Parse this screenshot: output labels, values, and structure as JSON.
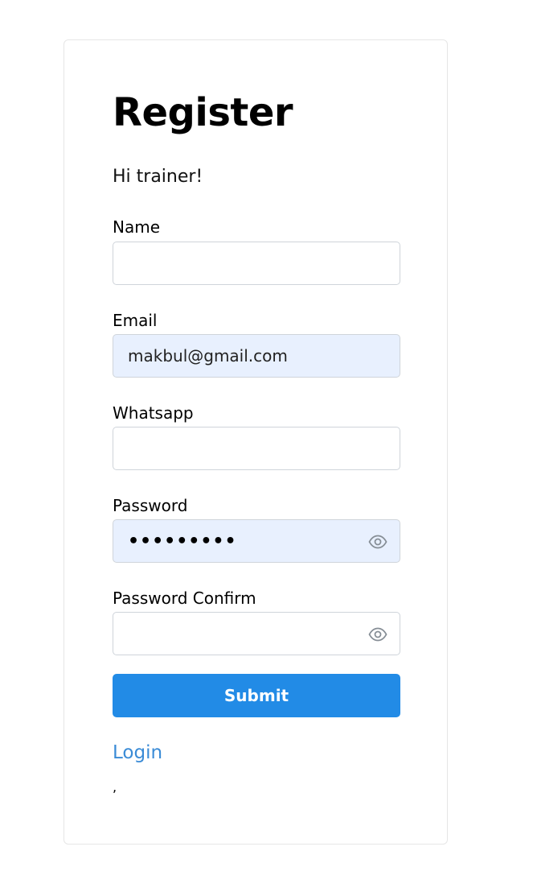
{
  "form": {
    "title": "Register",
    "subtitle": "Hi trainer!",
    "fields": {
      "name": {
        "label": "Name",
        "value": "",
        "placeholder": ""
      },
      "email": {
        "label": "Email",
        "value": "makbul@gmail.com"
      },
      "whatsapp": {
        "label": "Whatsapp",
        "value": "",
        "placeholder": ""
      },
      "password": {
        "label": "Password",
        "masked": "•••••••••",
        "toggle_icon": "eye-icon"
      },
      "password_confirm": {
        "label": "Password Confirm",
        "value": "",
        "toggle_icon": "eye-icon"
      }
    },
    "submit_label": "Submit",
    "login_link": "Login",
    "trailing_text": ","
  },
  "colors": {
    "primary": "#228be6",
    "link": "#3a8bd6",
    "autofill_bg": "#e8f0fe",
    "border": "#cfd4da"
  }
}
